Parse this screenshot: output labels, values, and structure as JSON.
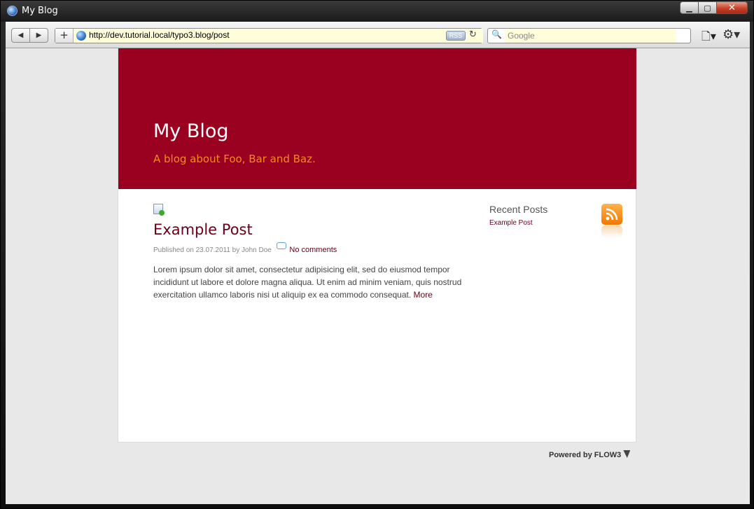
{
  "window": {
    "title": "My Blog",
    "buttons": {
      "minimize": "▁",
      "maximize": "▢",
      "close": "✕"
    }
  },
  "toolbar": {
    "url": "http://dev.tutorial.local/typo3.blog/post",
    "rss_label": "RSS",
    "search_placeholder": "Google",
    "icons": [
      "back-icon",
      "forward-icon",
      "add-bookmark-icon",
      "globe-icon",
      "reload-icon",
      "search-icon",
      "page-menu-icon",
      "gear-icon"
    ]
  },
  "blog": {
    "title": "My Blog",
    "subtitle": "A blog about Foo, Bar and Baz."
  },
  "post": {
    "title": "Example Post",
    "published": "Published on 23.07.2011 by John Doe",
    "comments": "No comments",
    "body": "Lorem ipsum dolor sit amet, consectetur adipisicing elit, sed do eiusmod tempor incididunt ut labore et dolore magna aliqua. Ut enim ad minim veniam, quis nostrud exercitation ullamco laboris nisi ut aliquip ex ea commodo consequat.",
    "more": "More"
  },
  "sidebar": {
    "heading": "Recent Posts",
    "items": [
      "Example Post"
    ]
  },
  "footer": {
    "powered": "Powered by FLOW3"
  },
  "colors": {
    "banner": "#9a0020",
    "subtitle": "#f28a20",
    "link": "#6a0018"
  }
}
